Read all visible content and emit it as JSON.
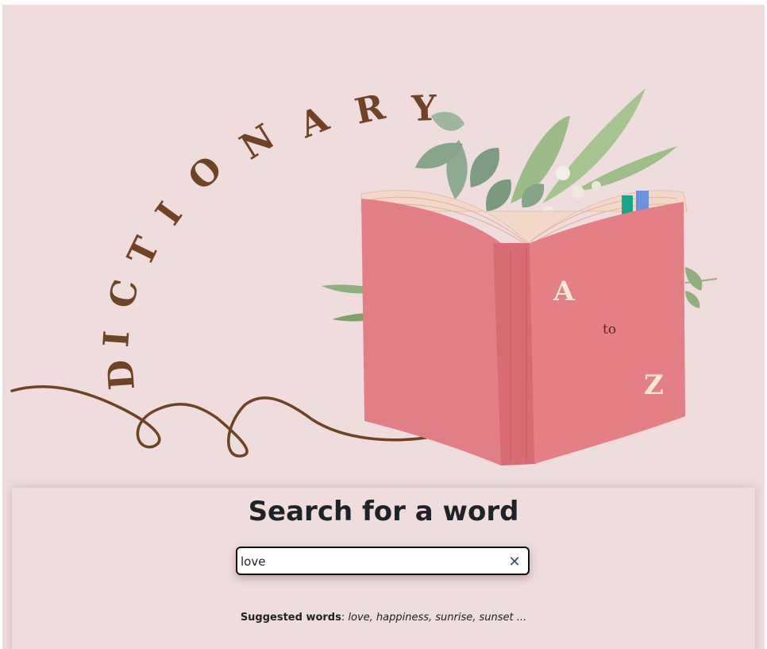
{
  "hero": {
    "title_letters": [
      "D",
      "I",
      "C",
      "T",
      "I",
      "O",
      "N",
      "A",
      "R",
      "Y"
    ],
    "book": {
      "letter_top": "A",
      "connector": "to",
      "letter_bottom": "Z"
    },
    "colors": {
      "brown": "#6e4326",
      "book": "#e27f86",
      "leaf": "#8fb07e",
      "background": "#efdcdd"
    }
  },
  "search": {
    "title": "Search for a word",
    "input_value": "love",
    "clear_icon": "close-icon",
    "suggested_label": "Suggested words",
    "suggested_sep": ":",
    "suggested_words": "love, happiness, sunrise, sunset ..."
  }
}
